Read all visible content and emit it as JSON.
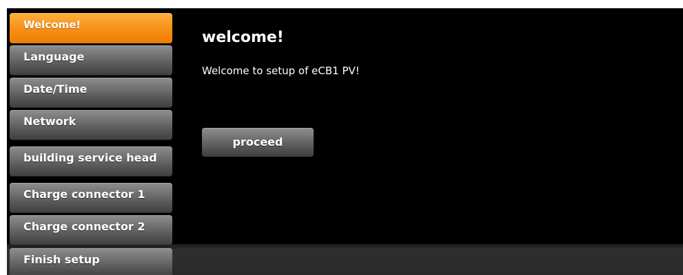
{
  "sidebar": {
    "items": [
      {
        "label": "Welcome!",
        "active": true
      },
      {
        "label": "Language",
        "active": false
      },
      {
        "label": "Date/Time",
        "active": false
      },
      {
        "label": "Network",
        "active": false
      },
      {
        "label": "building service head",
        "active": false
      },
      {
        "label": "Charge connector 1",
        "active": false
      },
      {
        "label": "Charge connector 2",
        "active": false
      },
      {
        "label": "Finish setup",
        "active": false
      }
    ]
  },
  "main": {
    "title": "welcome!",
    "message": "Welcome to setup of eCB1 PV!",
    "proceed_label": "proceed"
  },
  "colors": {
    "accent": "#f7941d",
    "background": "#000000",
    "button": "#6f6f6f"
  }
}
